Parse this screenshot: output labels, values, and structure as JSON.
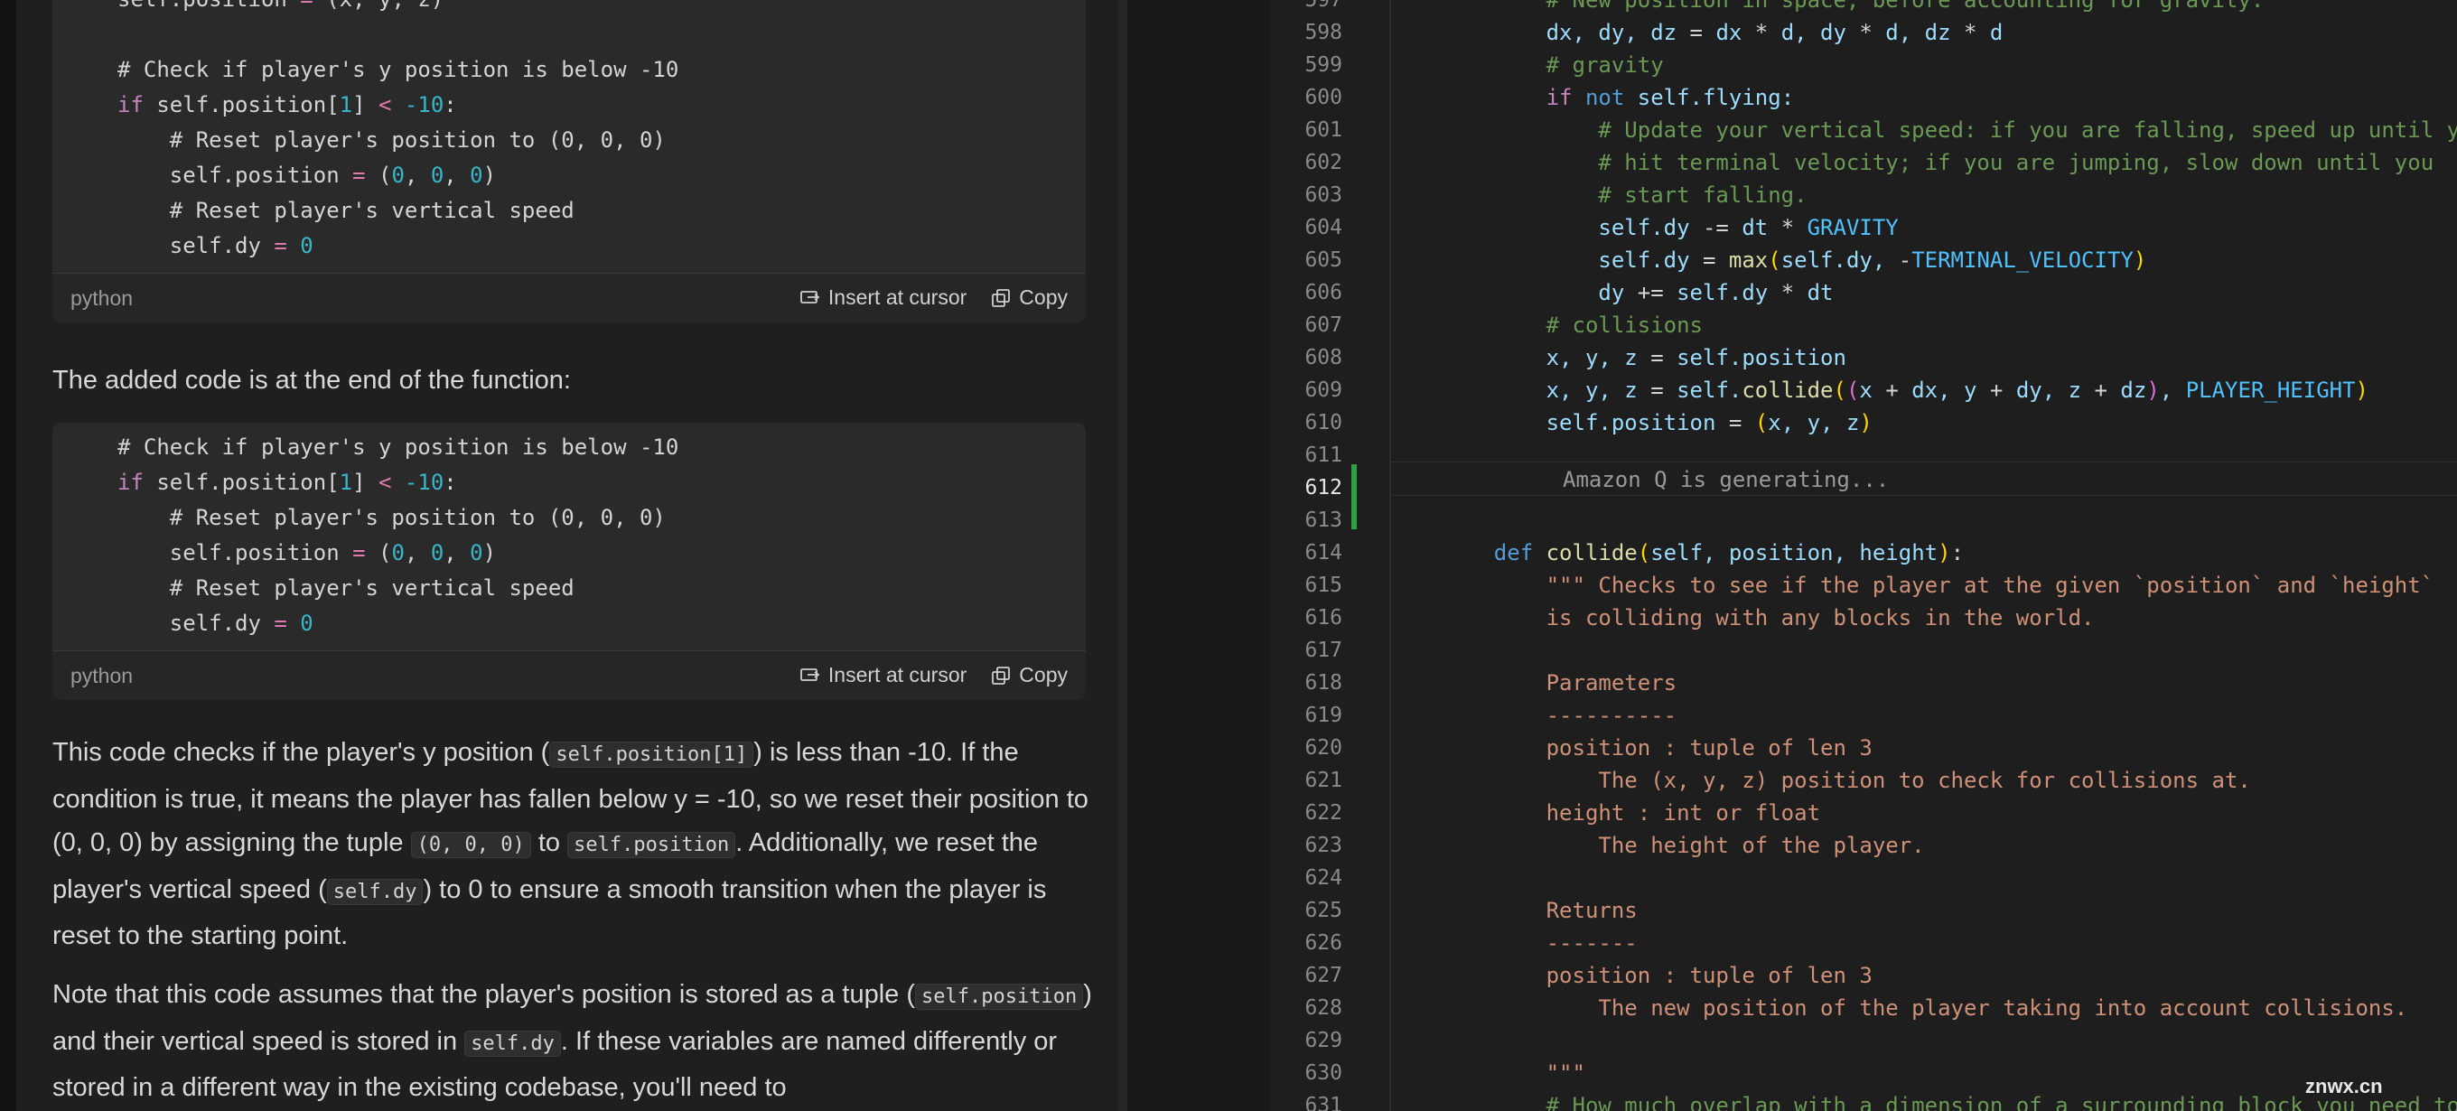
{
  "chat": {
    "blocks": [
      {
        "language": "python",
        "insert_label": "Insert at cursor",
        "copy_label": "Copy",
        "lines": [
          [
            {
              "t": "self.position ",
              "c": "c-cm"
            },
            {
              "t": "=",
              "c": "c-op"
            },
            {
              "t": " (x, y, z)",
              "c": "c-cm"
            }
          ],
          [],
          [
            {
              "t": "# Check if player's y position is below -10",
              "c": "c-cm"
            }
          ],
          [
            {
              "t": "if",
              "c": "c-kw"
            },
            {
              "t": " self.position[",
              "c": "c-cm"
            },
            {
              "t": "1",
              "c": "c-num"
            },
            {
              "t": "] ",
              "c": "c-cm"
            },
            {
              "t": "<",
              "c": "c-op"
            },
            {
              "t": " ",
              "c": "c-cm"
            },
            {
              "t": "-10",
              "c": "c-num"
            },
            {
              "t": ":",
              "c": "c-cm"
            }
          ],
          [
            {
              "t": "    # Reset player's position to (0, 0, 0)",
              "c": "c-cm"
            }
          ],
          [
            {
              "t": "    self.position ",
              "c": "c-cm"
            },
            {
              "t": "=",
              "c": "c-op"
            },
            {
              "t": " (",
              "c": "c-cm"
            },
            {
              "t": "0",
              "c": "c-num"
            },
            {
              "t": ", ",
              "c": "c-cm"
            },
            {
              "t": "0",
              "c": "c-num"
            },
            {
              "t": ", ",
              "c": "c-cm"
            },
            {
              "t": "0",
              "c": "c-num"
            },
            {
              "t": ")",
              "c": "c-cm"
            }
          ],
          [
            {
              "t": "    # Reset player's vertical speed",
              "c": "c-cm"
            }
          ],
          [
            {
              "t": "    self.dy ",
              "c": "c-cm"
            },
            {
              "t": "=",
              "c": "c-op"
            },
            {
              "t": " ",
              "c": "c-cm"
            },
            {
              "t": "0",
              "c": "c-num"
            }
          ]
        ]
      },
      {
        "language": "python",
        "insert_label": "Insert at cursor",
        "copy_label": "Copy",
        "lines": [
          [
            {
              "t": "# Check if player's y position is below -10",
              "c": "c-cm"
            }
          ],
          [
            {
              "t": "if",
              "c": "c-kw"
            },
            {
              "t": " self.position[",
              "c": "c-cm"
            },
            {
              "t": "1",
              "c": "c-num"
            },
            {
              "t": "] ",
              "c": "c-cm"
            },
            {
              "t": "<",
              "c": "c-op"
            },
            {
              "t": " ",
              "c": "c-cm"
            },
            {
              "t": "-10",
              "c": "c-num"
            },
            {
              "t": ":",
              "c": "c-cm"
            }
          ],
          [
            {
              "t": "    # Reset player's position to (0, 0, 0)",
              "c": "c-cm"
            }
          ],
          [
            {
              "t": "    self.position ",
              "c": "c-cm"
            },
            {
              "t": "=",
              "c": "c-op"
            },
            {
              "t": " (",
              "c": "c-cm"
            },
            {
              "t": "0",
              "c": "c-num"
            },
            {
              "t": ", ",
              "c": "c-cm"
            },
            {
              "t": "0",
              "c": "c-num"
            },
            {
              "t": ", ",
              "c": "c-cm"
            },
            {
              "t": "0",
              "c": "c-num"
            },
            {
              "t": ")",
              "c": "c-cm"
            }
          ],
          [
            {
              "t": "    # Reset player's vertical speed",
              "c": "c-cm"
            }
          ],
          [
            {
              "t": "    self.dy ",
              "c": "c-cm"
            },
            {
              "t": "=",
              "c": "c-op"
            },
            {
              "t": " ",
              "c": "c-cm"
            },
            {
              "t": "0",
              "c": "c-num"
            }
          ]
        ]
      }
    ],
    "intro_text": "The added code is at the end of the function:",
    "explanation": [
      {
        "t": "This code checks if the player's y position ("
      },
      {
        "code": "self.position[1]"
      },
      {
        "t": ") is less than -10. If the condition is true, it means the player has fallen below y = -10, so we reset their position to (0, 0, 0) by assigning the tuple "
      },
      {
        "code": "(0, 0, 0)"
      },
      {
        "t": " to "
      },
      {
        "code": "self.position"
      },
      {
        "t": ". Additionally, we reset the player's vertical speed ("
      },
      {
        "code": "self.dy"
      },
      {
        "t": ") to 0 to ensure a smooth transition when the player is reset to the starting point."
      }
    ],
    "note": [
      {
        "t": "Note that this code assumes that the player's position is stored as a tuple ("
      },
      {
        "code": "self.position"
      },
      {
        "t": ") and their vertical speed is stored in "
      },
      {
        "code": "self.dy"
      },
      {
        "t": ". If these variables are named differently or stored in a different way in the existing codebase, you'll need to"
      }
    ]
  },
  "editor": {
    "generating_label": "Amazon Q is generating...",
    "active_line": 612,
    "lines": [
      {
        "n": "597",
        "s": [
          {
            "t": "        # New position in space, before accounting for gravity.",
            "c": "t-cm"
          }
        ]
      },
      {
        "n": "598",
        "s": [
          {
            "t": "        dx, dy, dz ",
            "c": "t-var"
          },
          {
            "t": "=",
            "c": "t-op"
          },
          {
            "t": " dx ",
            "c": "t-var"
          },
          {
            "t": "*",
            "c": "t-op"
          },
          {
            "t": " d, dy ",
            "c": "t-var"
          },
          {
            "t": "*",
            "c": "t-op"
          },
          {
            "t": " d, dz ",
            "c": "t-var"
          },
          {
            "t": "*",
            "c": "t-op"
          },
          {
            "t": " d",
            "c": "t-var"
          }
        ]
      },
      {
        "n": "599",
        "s": [
          {
            "t": "        # gravity",
            "c": "t-cm"
          }
        ]
      },
      {
        "n": "600",
        "s": [
          {
            "t": "        ",
            "c": "t-op"
          },
          {
            "t": "if",
            "c": "t-kw"
          },
          {
            "t": " ",
            "c": "t-op"
          },
          {
            "t": "not",
            "c": "t-def"
          },
          {
            "t": " self.flying:",
            "c": "t-var"
          }
        ]
      },
      {
        "n": "601",
        "s": [
          {
            "t": "            # Update your vertical speed: if you are falling, speed up until you",
            "c": "t-cm"
          }
        ]
      },
      {
        "n": "602",
        "s": [
          {
            "t": "            # hit terminal velocity; if you are jumping, slow down until you",
            "c": "t-cm"
          }
        ]
      },
      {
        "n": "603",
        "s": [
          {
            "t": "            # start falling.",
            "c": "t-cm"
          }
        ]
      },
      {
        "n": "604",
        "s": [
          {
            "t": "            self.dy ",
            "c": "t-var"
          },
          {
            "t": "-=",
            "c": "t-op"
          },
          {
            "t": " dt ",
            "c": "t-var"
          },
          {
            "t": "*",
            "c": "t-op"
          },
          {
            "t": " ",
            "c": "t-op"
          },
          {
            "t": "GRAVITY",
            "c": "t-const"
          }
        ]
      },
      {
        "n": "605",
        "s": [
          {
            "t": "            self.dy ",
            "c": "t-var"
          },
          {
            "t": "=",
            "c": "t-op"
          },
          {
            "t": " ",
            "c": "t-op"
          },
          {
            "t": "max",
            "c": "t-fn"
          },
          {
            "t": "(",
            "c": "t-brk"
          },
          {
            "t": "self.dy, ",
            "c": "t-var"
          },
          {
            "t": "-",
            "c": "t-op"
          },
          {
            "t": "TERMINAL_VELOCITY",
            "c": "t-const"
          },
          {
            "t": ")",
            "c": "t-brk"
          }
        ]
      },
      {
        "n": "606",
        "s": [
          {
            "t": "            dy ",
            "c": "t-var"
          },
          {
            "t": "+=",
            "c": "t-op"
          },
          {
            "t": " self.dy ",
            "c": "t-var"
          },
          {
            "t": "*",
            "c": "t-op"
          },
          {
            "t": " dt",
            "c": "t-var"
          }
        ]
      },
      {
        "n": "607",
        "s": [
          {
            "t": "        # collisions",
            "c": "t-cm"
          }
        ]
      },
      {
        "n": "608",
        "s": [
          {
            "t": "        x, y, z ",
            "c": "t-var"
          },
          {
            "t": "=",
            "c": "t-op"
          },
          {
            "t": " self.position",
            "c": "t-var"
          }
        ]
      },
      {
        "n": "609",
        "s": [
          {
            "t": "        x, y, z ",
            "c": "t-var"
          },
          {
            "t": "=",
            "c": "t-op"
          },
          {
            "t": " self.",
            "c": "t-var"
          },
          {
            "t": "collide",
            "c": "t-fn"
          },
          {
            "t": "(",
            "c": "t-brk"
          },
          {
            "t": "(",
            "c": "t-brk2"
          },
          {
            "t": "x ",
            "c": "t-var"
          },
          {
            "t": "+",
            "c": "t-op"
          },
          {
            "t": " dx, y ",
            "c": "t-var"
          },
          {
            "t": "+",
            "c": "t-op"
          },
          {
            "t": " dy, z ",
            "c": "t-var"
          },
          {
            "t": "+",
            "c": "t-op"
          },
          {
            "t": " dz",
            "c": "t-var"
          },
          {
            "t": ")",
            "c": "t-brk2"
          },
          {
            "t": ", ",
            "c": "t-var"
          },
          {
            "t": "PLAYER_HEIGHT",
            "c": "t-const"
          },
          {
            "t": ")",
            "c": "t-brk"
          }
        ]
      },
      {
        "n": "610",
        "s": [
          {
            "t": "        self.position ",
            "c": "t-var"
          },
          {
            "t": "=",
            "c": "t-op"
          },
          {
            "t": " ",
            "c": "t-op"
          },
          {
            "t": "(",
            "c": "t-brk"
          },
          {
            "t": "x, y, z",
            "c": "t-var"
          },
          {
            "t": ")",
            "c": "t-brk"
          }
        ]
      },
      {
        "n": "611",
        "s": []
      },
      {
        "n": "612",
        "s": []
      },
      {
        "n": "613",
        "s": []
      },
      {
        "n": "614",
        "s": [
          {
            "t": "    ",
            "c": "t-op"
          },
          {
            "t": "def",
            "c": "t-def"
          },
          {
            "t": " ",
            "c": "t-op"
          },
          {
            "t": "collide",
            "c": "t-fn"
          },
          {
            "t": "(",
            "c": "t-brk"
          },
          {
            "t": "self, position, height",
            "c": "t-var"
          },
          {
            "t": ")",
            "c": "t-brk"
          },
          {
            "t": ":",
            "c": "t-op"
          }
        ]
      },
      {
        "n": "615",
        "s": [
          {
            "t": "        \"\"\" Checks to see if the player at the given `position` and `height`",
            "c": "t-str"
          }
        ]
      },
      {
        "n": "616",
        "s": [
          {
            "t": "        is colliding with any blocks in the world.",
            "c": "t-str"
          }
        ]
      },
      {
        "n": "617",
        "s": []
      },
      {
        "n": "618",
        "s": [
          {
            "t": "        Parameters",
            "c": "t-str"
          }
        ]
      },
      {
        "n": "619",
        "s": [
          {
            "t": "        ----------",
            "c": "t-str"
          }
        ]
      },
      {
        "n": "620",
        "s": [
          {
            "t": "        position : tuple of len 3",
            "c": "t-str"
          }
        ]
      },
      {
        "n": "621",
        "s": [
          {
            "t": "            The (x, y, z) position to check for collisions at.",
            "c": "t-str"
          }
        ]
      },
      {
        "n": "622",
        "s": [
          {
            "t": "        height : int or float",
            "c": "t-str"
          }
        ]
      },
      {
        "n": "623",
        "s": [
          {
            "t": "            The height of the player.",
            "c": "t-str"
          }
        ]
      },
      {
        "n": "624",
        "s": []
      },
      {
        "n": "625",
        "s": [
          {
            "t": "        Returns",
            "c": "t-str"
          }
        ]
      },
      {
        "n": "626",
        "s": [
          {
            "t": "        -------",
            "c": "t-str"
          }
        ]
      },
      {
        "n": "627",
        "s": [
          {
            "t": "        position : tuple of len 3",
            "c": "t-str"
          }
        ]
      },
      {
        "n": "628",
        "s": [
          {
            "t": "            The new position of the player taking into account collisions.",
            "c": "t-str"
          }
        ]
      },
      {
        "n": "629",
        "s": []
      },
      {
        "n": "630",
        "s": [
          {
            "t": "        \"\"\"",
            "c": "t-str"
          }
        ]
      },
      {
        "n": "631",
        "s": [
          {
            "t": "        # How much overlap with a dimension of a surrounding block you need to",
            "c": "t-cm"
          }
        ]
      }
    ]
  },
  "watermark": "znwx.cn"
}
